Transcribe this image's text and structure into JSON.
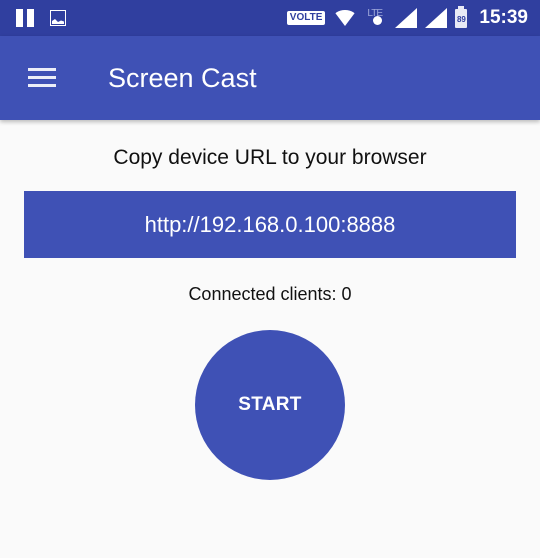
{
  "status_bar": {
    "left_icons": [
      "pause-icon",
      "image-icon"
    ],
    "volte_label": "VOLTE",
    "lte_label": "LTE",
    "battery_level": "89",
    "time": "15:39"
  },
  "app_bar": {
    "menu_icon": "hamburger-menu-icon",
    "title": "Screen Cast"
  },
  "main": {
    "instruction": "Copy device URL to your browser",
    "url": "http://192.168.0.100:8888",
    "connected_clients_label": "Connected clients: 0",
    "start_button_label": "START"
  },
  "colors": {
    "status_bar": "#303f9f",
    "primary": "#3f51b5",
    "background": "#fafafa"
  }
}
